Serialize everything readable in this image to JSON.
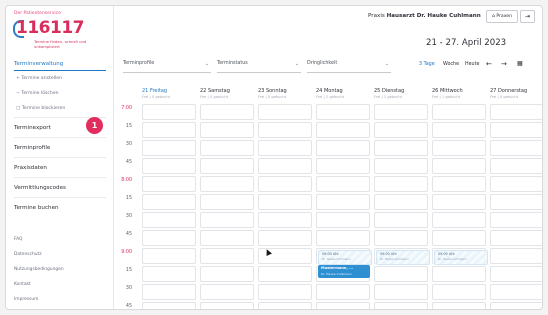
{
  "logo": {
    "tagline": "Der Patientenservice",
    "number": "116117",
    "sub": "Termine finden, schnell und unkompliziert"
  },
  "sidebar": {
    "active_section": "Terminverwaltung",
    "subitems": [
      "Termine anstellen",
      "Termine löschen",
      "Termine blockieren"
    ],
    "items": [
      "Terminexport",
      "Terminprofile",
      "Praxisdaten",
      "Vermittlungscodes",
      "Termine buchen"
    ],
    "footer": [
      "FAQ",
      "Datenschutz",
      "Nutzungsbedingungen",
      "Kontakt",
      "Impressum"
    ],
    "badge": "1"
  },
  "header": {
    "practice_label": "Praxis",
    "practice_name": "Hausarzt Dr. Hauke Cuhlmann",
    "praxen_button": "Praxen",
    "logout_icon": "logout-icon",
    "date_range": "21 - 27. April 2023"
  },
  "filters": {
    "terminprofile": "Terminprofile",
    "terminstatus": "Terminstatus",
    "dringlichkeit": "Dringlichkeit"
  },
  "view": {
    "modes": [
      "3 Tage",
      "Woche",
      "Heute"
    ],
    "active_mode": "3 Tage",
    "prev": "←",
    "next": "→",
    "calendar_icon": "calendar-icon"
  },
  "calendar": {
    "days": [
      {
        "label": "21 Freitag",
        "sub": "Frei | 0 gebucht",
        "today": true
      },
      {
        "label": "22 Samstag",
        "sub": "Frei | 0 gebucht",
        "today": false
      },
      {
        "label": "23 Sonntag",
        "sub": "Frei | 0 gebucht",
        "today": false
      },
      {
        "label": "24 Montag",
        "sub": "Frei | 2 gebucht",
        "today": false
      },
      {
        "label": "25 Dienstag",
        "sub": "Frei | 1 gebucht",
        "today": false
      },
      {
        "label": "26 Mittwoch",
        "sub": "Frei | 1 gebucht",
        "today": false
      },
      {
        "label": "27 Donnerstag",
        "sub": "Frei | 0 gebucht",
        "today": false
      }
    ],
    "times": [
      "7:00",
      "15",
      "30",
      "45",
      "8:00",
      "15",
      "30",
      "45",
      "9:00",
      "15",
      "30",
      "45"
    ],
    "red_times": [
      "7:00",
      "8:00",
      "9:00"
    ],
    "appointments": {
      "monday_1_time": "09:00 Uhr",
      "monday_1_name": "Dr. Hauke Cuhlmann",
      "monday_2_title": "Mustermann, ...",
      "monday_2_name": "Dr. Hauke Cuhlmann",
      "tuesday_time": "09:00 Uhr",
      "tuesday_name": "Dr. Hauke Cuhlmann",
      "wednesday_time": "09:00 Uhr",
      "wednesday_name": "Dr. Hauke Cuhlmann"
    }
  }
}
